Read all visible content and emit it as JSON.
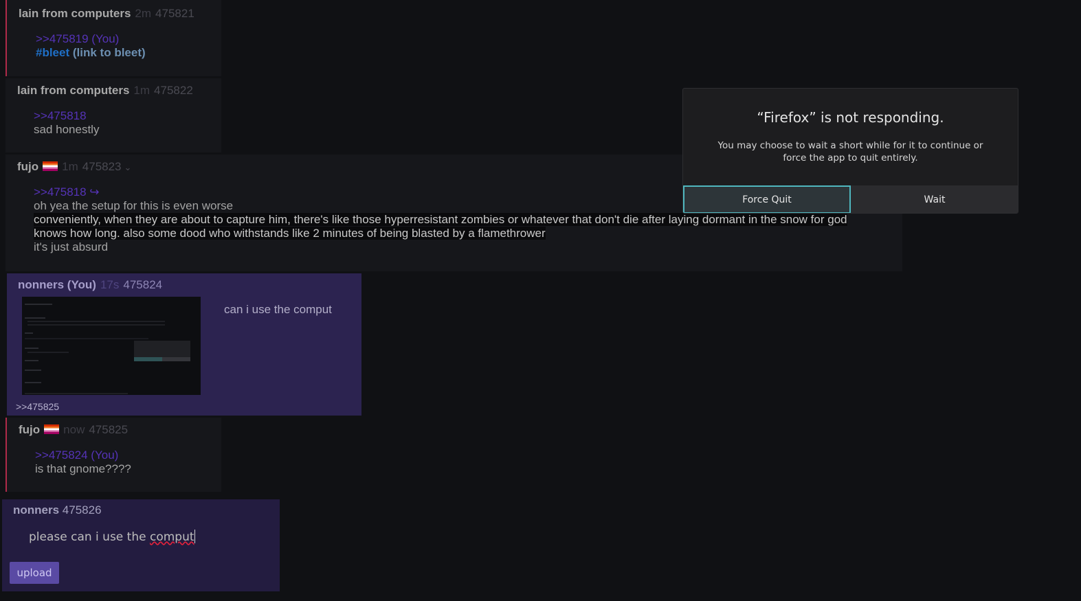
{
  "posts": [
    {
      "name": "lain from computers",
      "time": "2m",
      "num": "475821",
      "quote": ">>475819 (You)",
      "hashtag": "#bleet",
      "link_open": "(",
      "link": "link to bleet",
      "link_close": ")"
    },
    {
      "name": "lain from computers",
      "time": "1m",
      "num": "475822",
      "quote": ">>475818",
      "text": "sad honestly"
    },
    {
      "name": "fujo",
      "time": "1m",
      "num": "475823",
      "flag": "lesbian-flag",
      "chevron": "⌄",
      "quote": ">>475818 ↪",
      "lines": [
        "oh yea the setup for this is even worse",
        "conveniently, when they are about to capture him, there's like those hyperresistant zombies or whatever that don't die after laying dormant in the snow for god ",
        "knows how long. also some dood who withstands like 2 minutes of being blasted by a flamethrower",
        "it's just absurd"
      ]
    },
    {
      "name": "nonners (You)",
      "time": "17s",
      "num": "475824",
      "text": "can i use the comput",
      "reply_link": ">>475825"
    },
    {
      "name": "fujo",
      "time": "now",
      "num": "475825",
      "flag": "lesbian-flag",
      "quote": ">>475824 (You)",
      "text": "is that gnome????"
    }
  ],
  "reply_box": {
    "name": "nonners",
    "num": "475826",
    "input_text": "please can i use the ",
    "input_misspelled": "comput",
    "upload_label": "upload"
  },
  "dialog": {
    "title": "“Firefox” is not responding.",
    "message": "You may choose to wait a short while for it to continue or force the app to quit entirely.",
    "force_quit_label": "Force Quit",
    "wait_label": "Wait",
    "accent": "#4fb7bf"
  }
}
